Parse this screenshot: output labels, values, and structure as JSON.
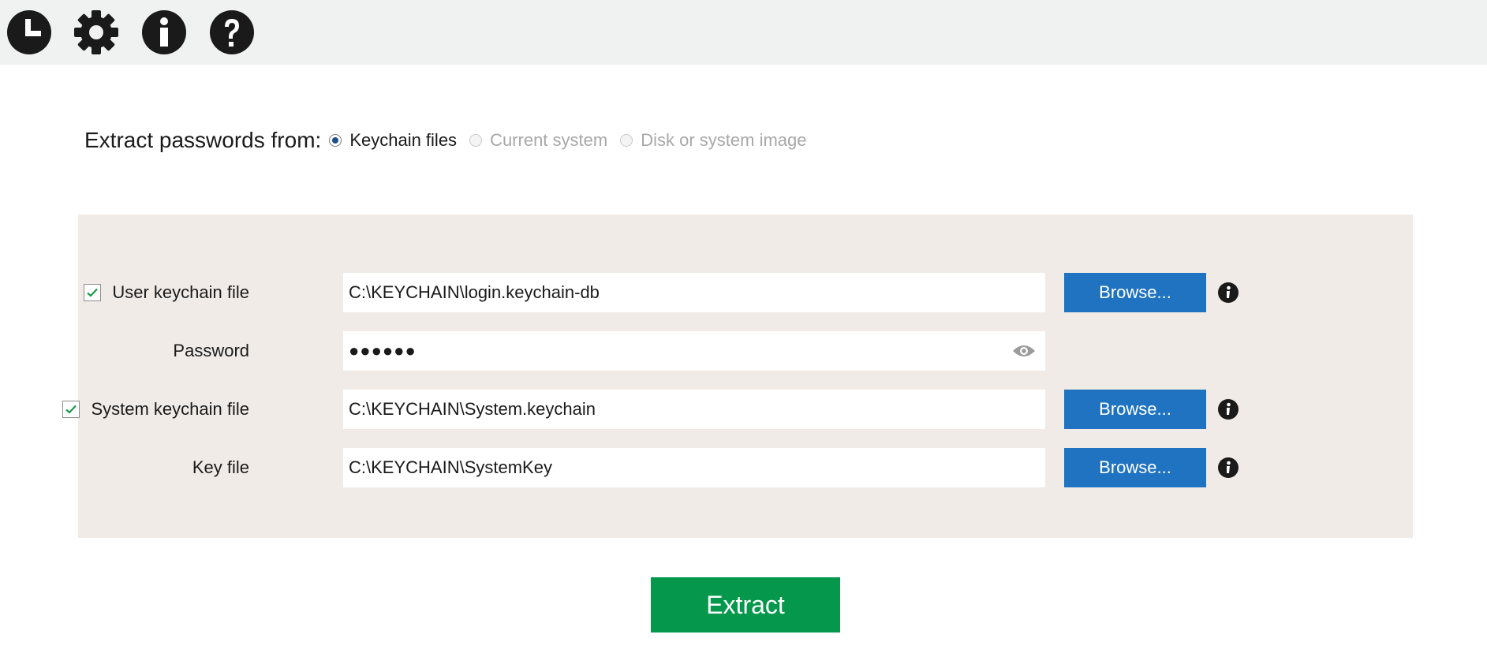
{
  "toolbar": {
    "icons": [
      "history-icon",
      "settings-gear-icon",
      "info-icon",
      "help-icon"
    ]
  },
  "source": {
    "label": "Extract passwords from:",
    "options": [
      {
        "label": "Keychain files",
        "selected": true,
        "enabled": true
      },
      {
        "label": "Current system",
        "selected": false,
        "enabled": false
      },
      {
        "label": "Disk or system image",
        "selected": false,
        "enabled": false
      }
    ]
  },
  "form": {
    "user_keychain": {
      "label": "User keychain file",
      "checked": true,
      "value": "C:\\KEYCHAIN\\login.keychain-db",
      "browse_label": "Browse..."
    },
    "password": {
      "label": "Password",
      "value_masked": "●●●●●●"
    },
    "system_keychain": {
      "label": "System keychain file",
      "checked": true,
      "value": "C:\\KEYCHAIN\\System.keychain",
      "browse_label": "Browse..."
    },
    "key_file": {
      "label": "Key file",
      "value": "C:\\KEYCHAIN\\SystemKey",
      "browse_label": "Browse..."
    }
  },
  "actions": {
    "extract_label": "Extract"
  },
  "colors": {
    "toolbar_bg": "#f0f1f1",
    "panel_bg": "#f0ebe7",
    "browse_bg": "#1f73c1",
    "extract_bg": "#05984c",
    "check_color": "#1a9a4a"
  }
}
